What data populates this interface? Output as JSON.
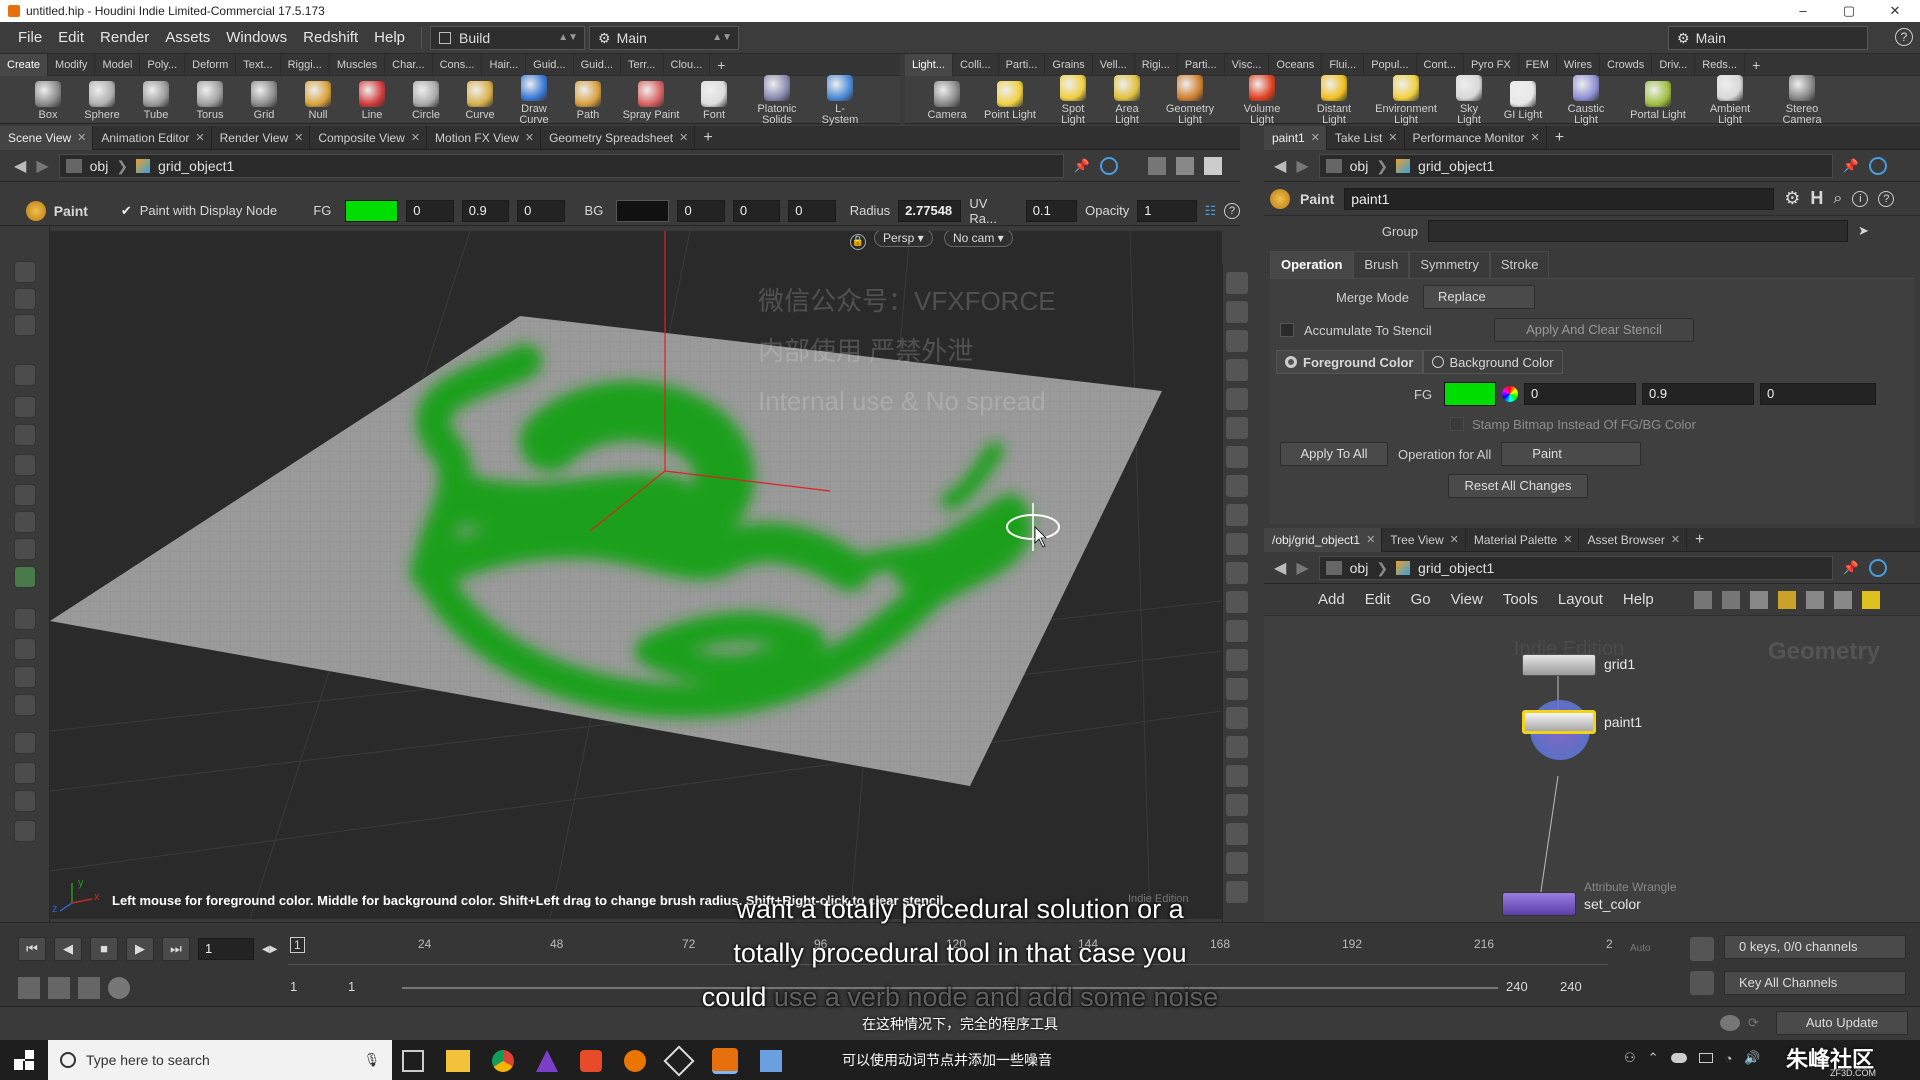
{
  "window": {
    "title": "untitled.hip - Houdini Indie Limited-Commercial 17.5.173",
    "minimize": "–",
    "maximize": "▢",
    "close": "✕"
  },
  "menu": {
    "items": [
      "File",
      "Edit",
      "Render",
      "Assets",
      "Windows",
      "Redshift",
      "Help"
    ],
    "desktop": "Build",
    "context": "Main",
    "right_context": "Main"
  },
  "shelf_left": {
    "tabs": [
      "Create",
      "Modify",
      "Model",
      "Poly...",
      "Deform",
      "Text...",
      "Riggi...",
      "Muscles",
      "Char...",
      "Cons...",
      "Hair...",
      "Guid...",
      "Guid...",
      "Terr...",
      "Clou..."
    ],
    "tools": [
      "Box",
      "Sphere",
      "Tube",
      "Torus",
      "Grid",
      "Null",
      "Line",
      "Circle",
      "Curve",
      "Draw Curve",
      "Path",
      "Spray Paint",
      "Font",
      "Platonic Solids",
      "L-System"
    ]
  },
  "shelf_right": {
    "tabs": [
      "Light...",
      "Colli...",
      "Parti...",
      "Grains",
      "Vell...",
      "Rigi...",
      "Parti...",
      "Visc...",
      "Oceans",
      "Flui...",
      "Popul...",
      "Cont...",
      "Pyro FX",
      "FEM",
      "Wires",
      "Crowds",
      "Driv...",
      "Reds..."
    ],
    "tools": [
      "Camera",
      "Point Light",
      "Spot Light",
      "Area Light",
      "Geometry Light",
      "Volume Light",
      "Distant Light",
      "Environment Light",
      "Sky Light",
      "GI Light",
      "Caustic Light",
      "Portal Light",
      "Ambient Light",
      "Stereo Camera"
    ]
  },
  "left_pane": {
    "tabs": [
      "Scene View",
      "Animation Editor",
      "Render View",
      "Composite View",
      "Motion FX View",
      "Geometry Spreadsheet"
    ],
    "path": {
      "root": "obj",
      "node": "grid_object1"
    }
  },
  "paint_toolbar": {
    "tool": "Paint",
    "display_node": "Paint with Display Node",
    "fg_label": "FG",
    "fg_color": "#00dd00",
    "fg": [
      "0",
      "0.9",
      "0"
    ],
    "bg_label": "BG",
    "bg_color": "#111111",
    "bg": [
      "0",
      "0",
      "0"
    ],
    "radius_label": "Radius",
    "radius": "2.77548",
    "uv_label": "UV Ra...",
    "uv": "0.1",
    "opacity_label": "Opacity",
    "opacity": "1"
  },
  "viewport": {
    "persp": "Persp ▾",
    "cam": "No cam ▾",
    "status": "Left mouse for foreground color. Middle for background color. Shift+Left drag to change brush radius. Shift+Right-click to clear stencil",
    "watermark_badge": "Indie Edition",
    "watermark_lines": [
      "微信公众号：VFXFORCE",
      "内部使用 严禁外泄",
      "Internal use & No spread"
    ],
    "axis_x": "x",
    "axis_y": "y",
    "axis_z": "z"
  },
  "params_pane": {
    "tabs": [
      "paint1",
      "Take List",
      "Performance Monitor"
    ],
    "path": {
      "root": "obj",
      "node": "grid_object1"
    },
    "node_type": "Paint",
    "node_name": "paint1",
    "group_label": "Group",
    "group_value": "",
    "sub_tabs": [
      "Operation",
      "Brush",
      "Symmetry",
      "Stroke"
    ],
    "merge_label": "Merge Mode",
    "merge_value": "Replace",
    "accumulate": "Accumulate To Stencil",
    "apply_clear": "Apply And Clear Stencil",
    "fg_option": "Foreground Color",
    "bg_option": "Background Color",
    "fg_label": "FG",
    "fg_color": "#00dd00",
    "fg": [
      "0",
      "0.9",
      "0"
    ],
    "stamp": "Stamp Bitmap Instead Of FG/BG Color",
    "apply_all": "Apply To All",
    "op_all_label": "Operation for All",
    "op_all_value": "Paint",
    "reset": "Reset All Changes"
  },
  "network_pane": {
    "tabs": [
      "/obj/grid_object1",
      "Tree View",
      "Material Palette",
      "Asset Browser"
    ],
    "path": {
      "root": "obj",
      "node": "grid_object1"
    },
    "menu": [
      "Add",
      "Edit",
      "Go",
      "View",
      "Tools",
      "Layout",
      "Help"
    ],
    "watermark": "Indie Edition",
    "context_label": "Geometry",
    "nodes": [
      {
        "name": "grid1",
        "type": ""
      },
      {
        "name": "paint1",
        "type": ""
      },
      {
        "name": "set_color",
        "type": "Attribute Wrangle"
      }
    ]
  },
  "timeline": {
    "frame": "1",
    "marker": "1",
    "ticks": [
      "24",
      "48",
      "72",
      "96",
      "120",
      "144",
      "168",
      "192",
      "216",
      "2"
    ],
    "start": "1",
    "start2": "1",
    "end": "240",
    "end2": "240",
    "keys": "0 keys, 0/0 channels",
    "key_all": "Key All Channels",
    "auto_update": "Auto Update",
    "auto": "Auto"
  },
  "subtitle": {
    "line1": "want a totally procedural solution or a",
    "line2": "totally procedural tool in that case you",
    "line3a": "could",
    "line3b": "use a verb node and add some noise",
    "cn1": "在这种情况下，完全的程序工具",
    "cn2": "可以使用动词节点并添加一些噪音"
  },
  "taskbar": {
    "search": "Type here to search",
    "corner_logo": "朱峰社区",
    "corner_sub": "ZF3D.COM"
  }
}
